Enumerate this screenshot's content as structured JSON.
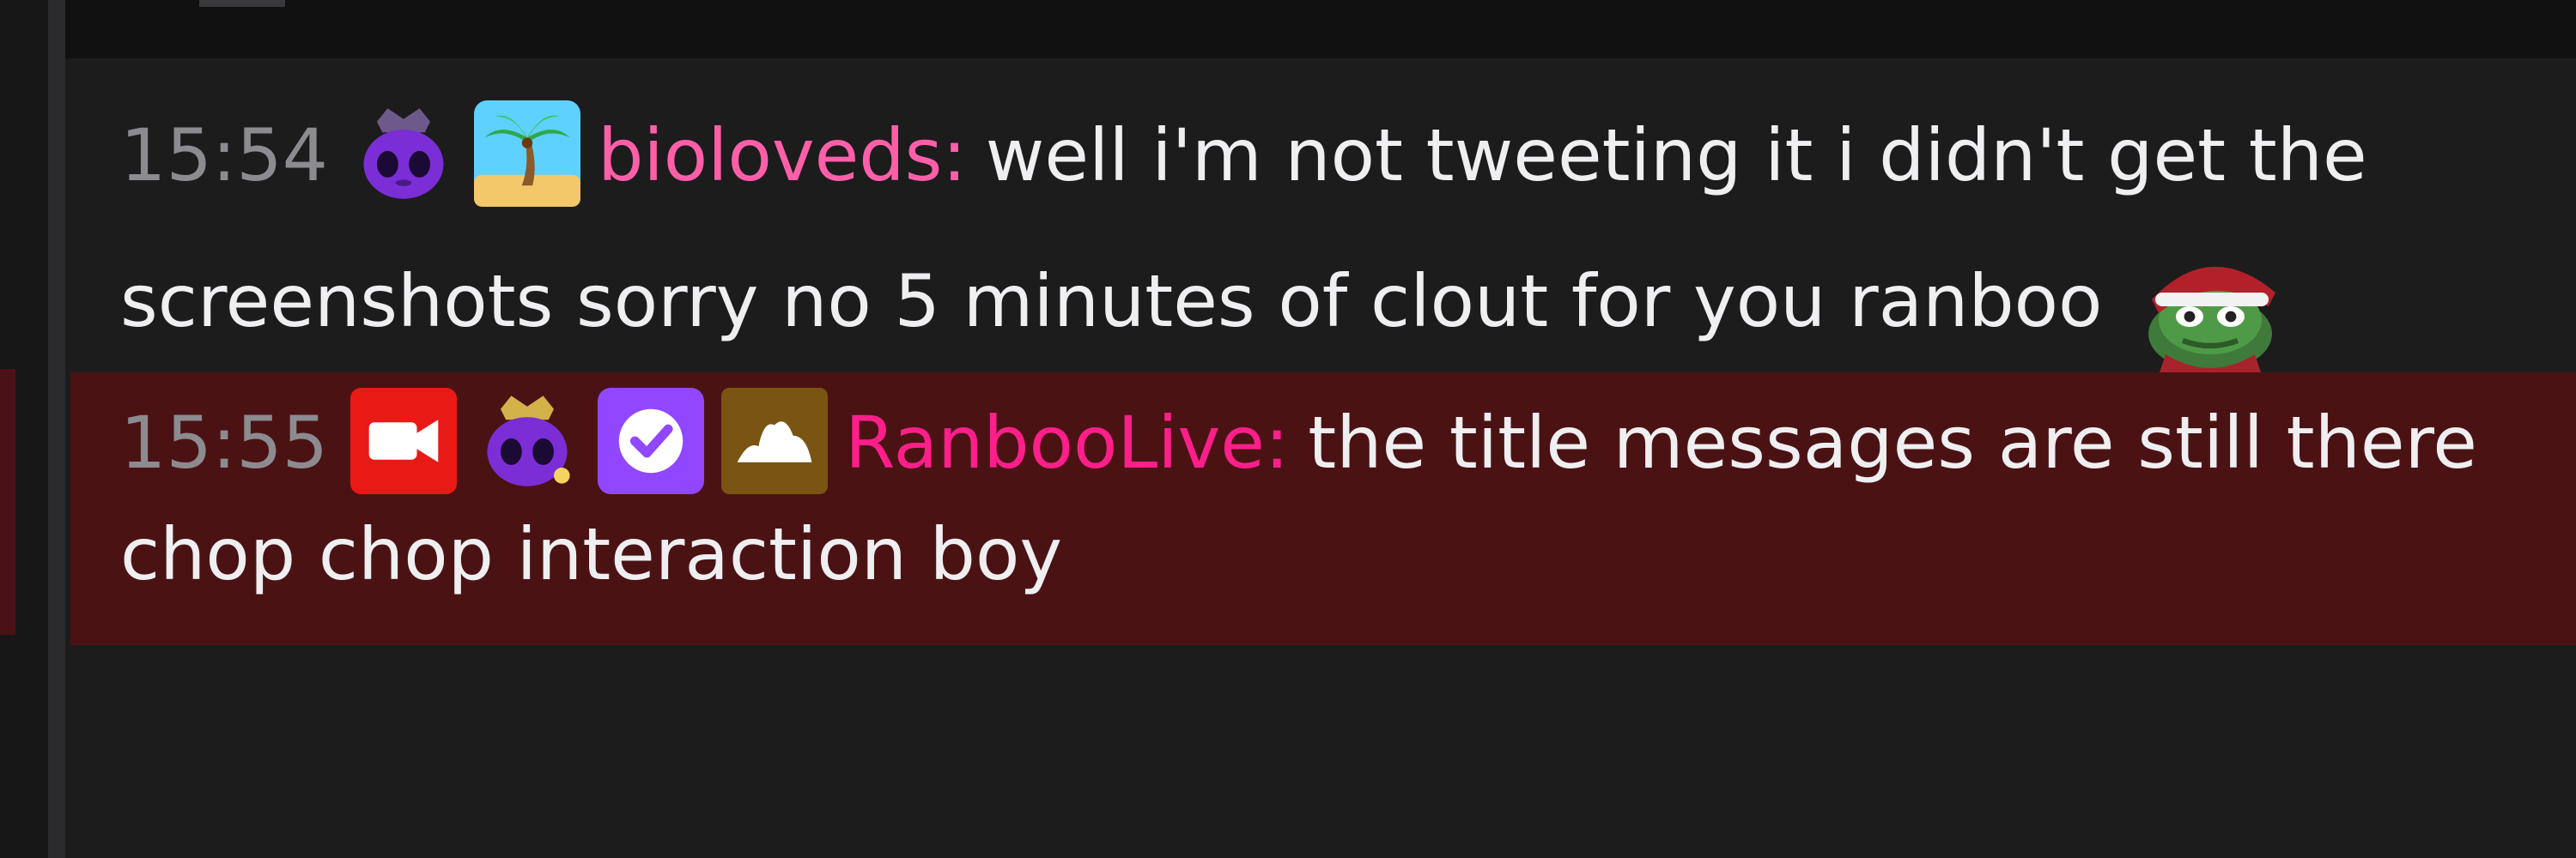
{
  "chat": {
    "messages": [
      {
        "time": "15:54",
        "badges": [
          {
            "name": "purple-crown-blob-badge"
          },
          {
            "name": "palm-tree-island-badge"
          }
        ],
        "username": "bioloveds",
        "separator": ":",
        "text": "well i'm not tweeting it i didn't get the screenshots sorry no 5 minutes of clout for you ranboo",
        "emote": "peepo-christmas-emote",
        "username_color": "#ff5fa8"
      },
      {
        "time": "15:55",
        "badges": [
          {
            "name": "broadcaster-camera-badge"
          },
          {
            "name": "purple-crown-blob-badge"
          },
          {
            "name": "verified-check-badge"
          },
          {
            "name": "mountain-peak-badge"
          }
        ],
        "username": "RanbooLive",
        "separator": ":",
        "text": "the title messages are still there chop chop interaction boy",
        "username_color": "#ff1f8a",
        "highlight_color": "#4b1214"
      }
    ]
  }
}
